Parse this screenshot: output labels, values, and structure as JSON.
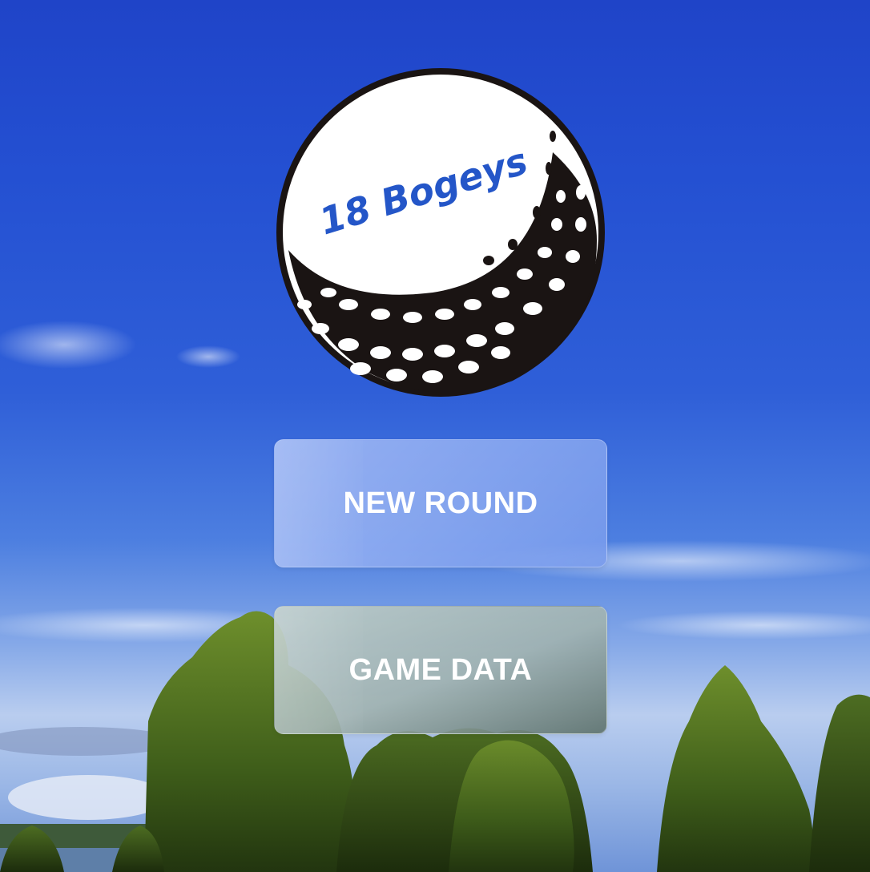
{
  "app": {
    "logo_text": "18 Bogeys"
  },
  "menu": {
    "new_round_label": "NEW ROUND",
    "game_data_label": "GAME DATA"
  },
  "colors": {
    "logo_text": "#2456c8",
    "button_text": "#ffffff"
  },
  "icons": {
    "logo": "golf-ball-logo"
  }
}
